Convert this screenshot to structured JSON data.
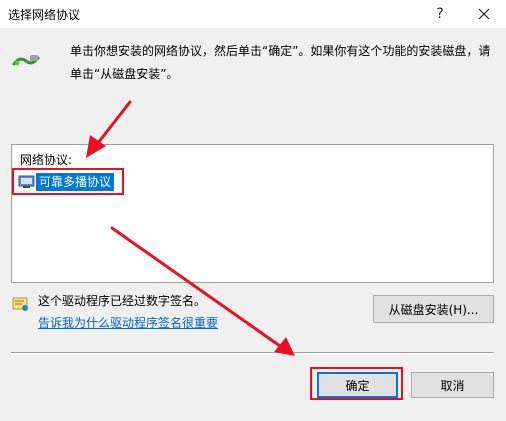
{
  "window": {
    "title": "选择网络协议",
    "help_label": "?"
  },
  "instructions": {
    "text": "单击你想安装的网络协议，然后单击“确定”。如果你有这个功能的安装磁盘，请单击“从磁盘安装”。"
  },
  "protocol_list": {
    "label": "网络协议:",
    "items": [
      {
        "label": "可靠多播协议",
        "selected": true
      }
    ]
  },
  "driver": {
    "signed_text": "这个驱动程序已经过数字签名。",
    "link_text": "告诉我为什么驱动程序签名很重要"
  },
  "buttons": {
    "have_disk": "从磁盘安装(H)...",
    "ok": "确定",
    "cancel": "取消"
  },
  "colors": {
    "selection": "#0078d7",
    "annotation": "#e81123",
    "link": "#0066cc"
  }
}
